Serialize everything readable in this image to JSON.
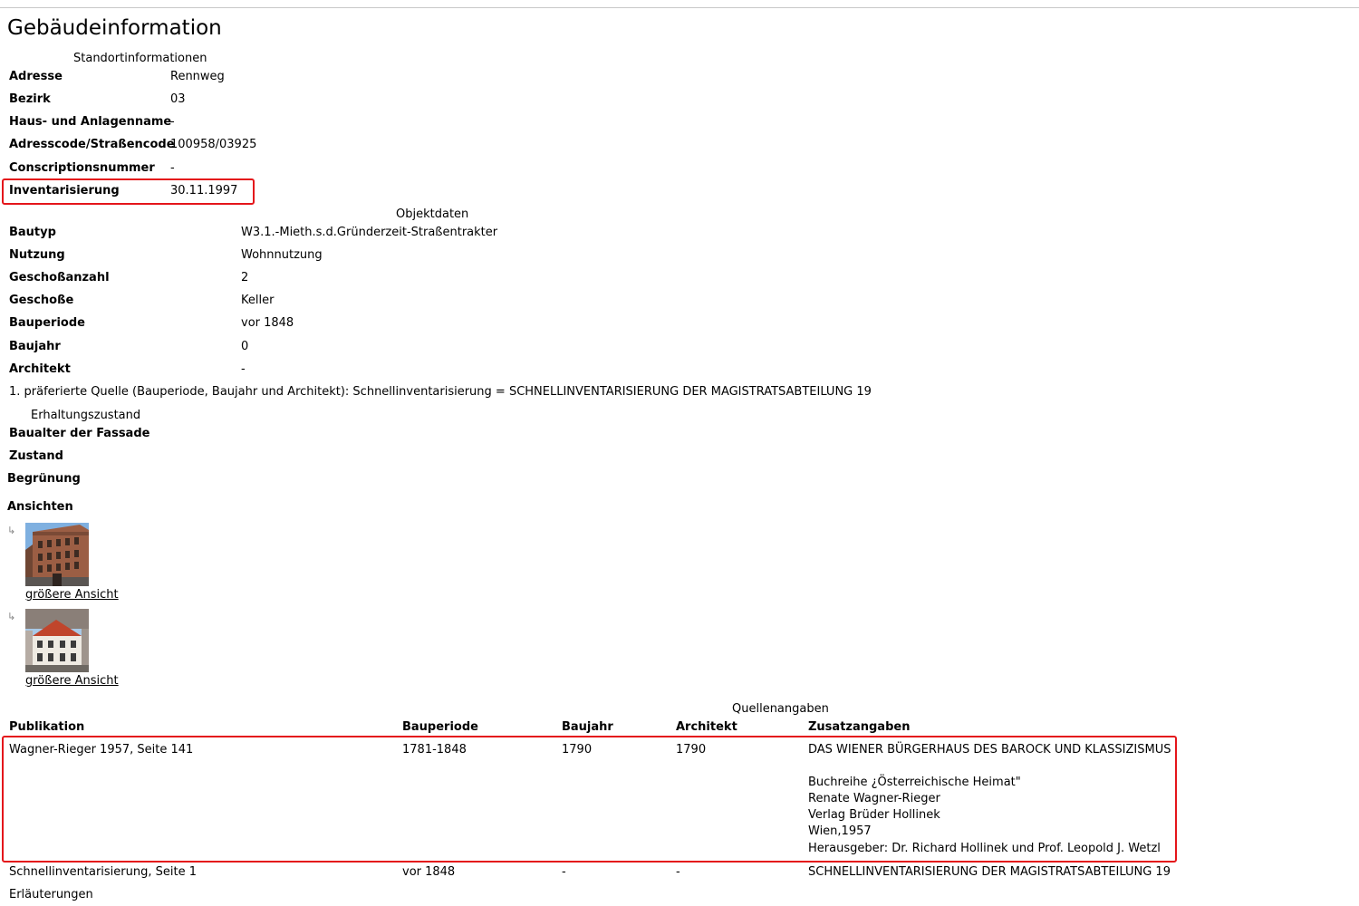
{
  "page": {
    "title": "Gebäudeinformation"
  },
  "standort": {
    "caption": "Standortinformationen",
    "rows": [
      {
        "label": "Adresse",
        "value": "Rennweg"
      },
      {
        "label": "Bezirk",
        "value": "03"
      },
      {
        "label": "Haus- und Anlagenname",
        "value": "-"
      },
      {
        "label": "Adresscode/Straßencode",
        "value": "100958/03925"
      },
      {
        "label": "Conscriptionsnummer",
        "value": "-"
      },
      {
        "label": "Inventarisierung",
        "value": "30.11.1997"
      }
    ]
  },
  "objekt": {
    "caption": "Objektdaten",
    "rows": [
      {
        "label": "Bautyp",
        "value": "W3.1.-Mieth.s.d.Gründerzeit-Straßentrakter"
      },
      {
        "label": "Nutzung",
        "value": "Wohnnutzung"
      },
      {
        "label": "Geschoßanzahl",
        "value": "2"
      },
      {
        "label": "Geschoße",
        "value": "Keller"
      },
      {
        "label": "Bauperiode",
        "value": "vor 1848"
      },
      {
        "label": "Baujahr",
        "value": "0"
      },
      {
        "label": "Architekt",
        "value": "-"
      }
    ],
    "note": "1. präferierte Quelle (Bauperiode, Baujahr und Architekt): Schnellinventarisierung = SCHNELLINVENTARISIERUNG DER MAGISTRATSABTEILUNG 19"
  },
  "erhaltung": {
    "caption": "Erhaltungszustand",
    "rows": [
      {
        "label": "Baualter der Fassade",
        "value": "-"
      },
      {
        "label": "Zustand",
        "value": ""
      },
      {
        "label": "Begrünung",
        "value": ""
      }
    ]
  },
  "ansichten": {
    "heading": "Ansichten",
    "arrow": "↳",
    "items": [
      {
        "link": "größere Ansicht"
      },
      {
        "link": "größere Ansicht"
      }
    ]
  },
  "quellen": {
    "caption": "Quellenangaben",
    "headers": [
      "Publikation",
      "Bauperiode",
      "Baujahr",
      "Architekt",
      "Zusatzangaben"
    ],
    "rows": [
      {
        "publikation": "Wagner-Rieger 1957, Seite 141",
        "bauperiode": "1781-1848",
        "baujahr": "1790",
        "architekt": "1790",
        "zusatz": [
          "DAS WIENER BÜRGERHAUS DES BAROCK UND KLASSIZISMUS",
          "",
          "Buchreihe ¿Österreichische Heimat\"",
          "Renate Wagner-Rieger",
          "Verlag Brüder Hollinek",
          "Wien,1957",
          "Herausgeber: Dr. Richard Hollinek und Prof. Leopold J. Wetzl"
        ]
      },
      {
        "publikation": "Schnellinventarisierung, Seite 1",
        "bauperiode": "vor 1848",
        "baujahr": "-",
        "architekt": "-",
        "zusatz": [
          "SCHNELLINVENTARISIERUNG DER MAGISTRATSABTEILUNG 19"
        ]
      }
    ],
    "footer": "Erläuterungen"
  },
  "colors": {
    "highlight": "#e4161b",
    "divider": "#c8c8c8"
  }
}
